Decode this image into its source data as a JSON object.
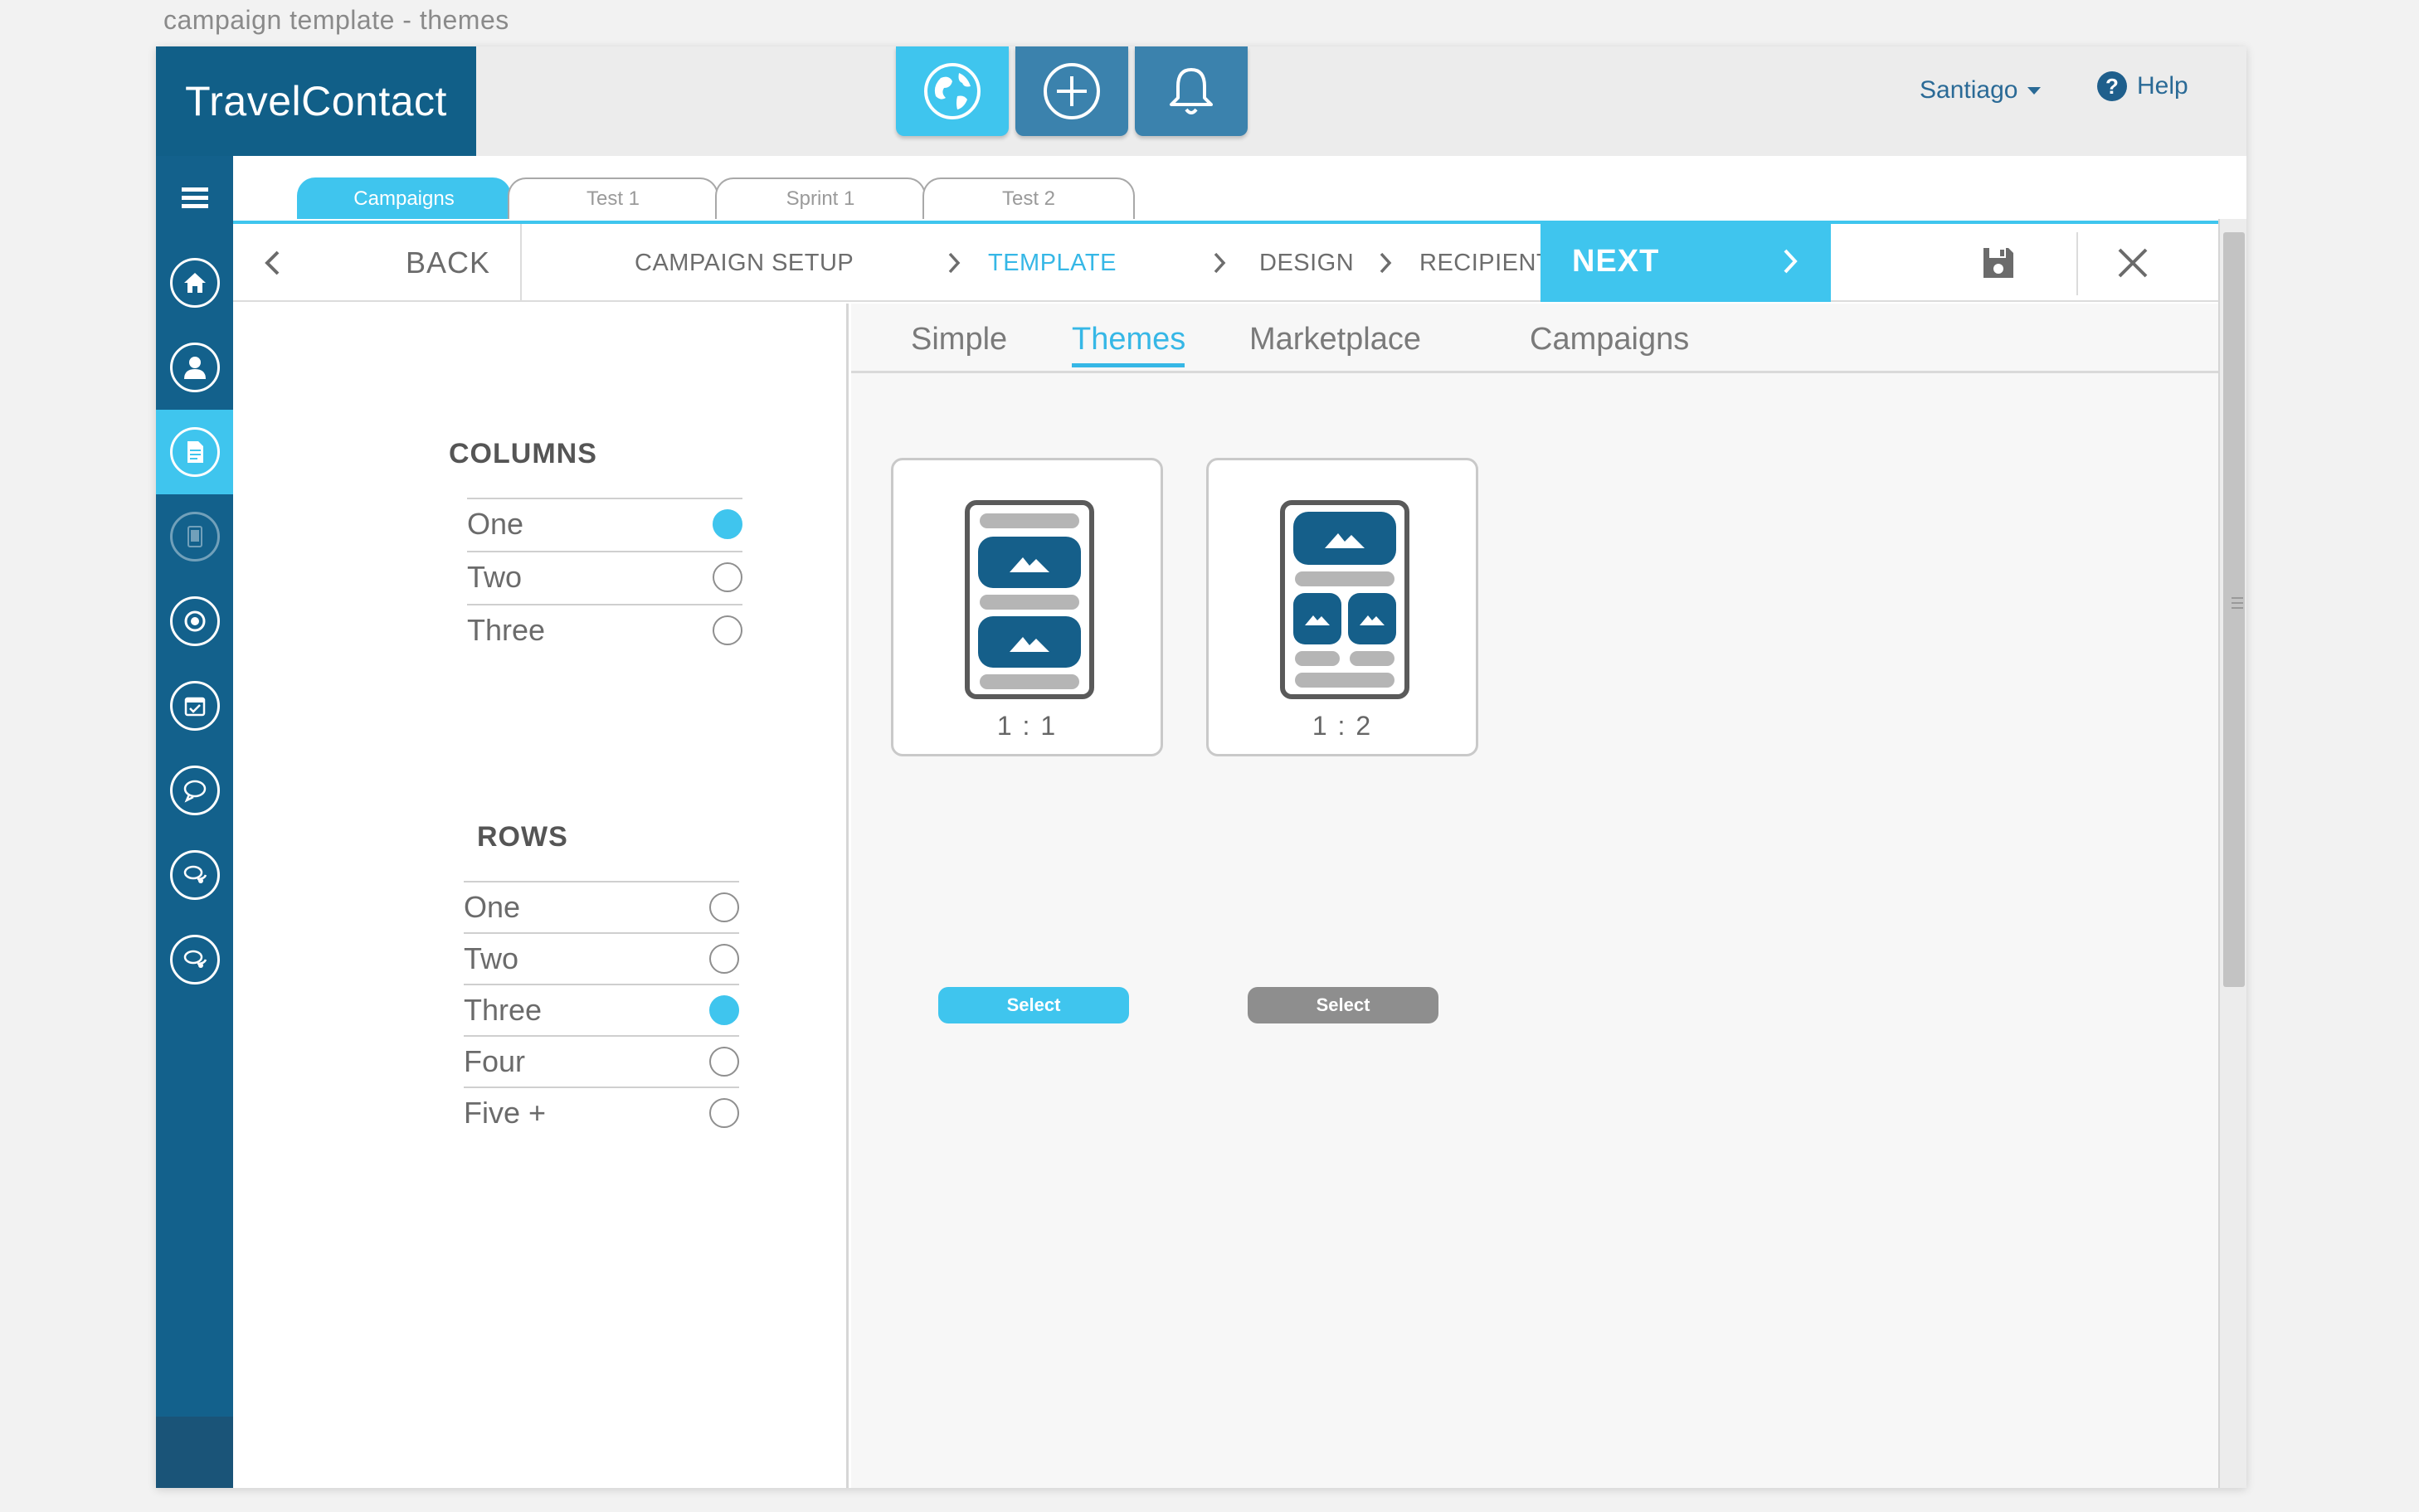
{
  "page_title": "campaign template - themes",
  "brand": {
    "logo_text": "TravelContact",
    "primary_color": "#115f88",
    "accent_color": "#3fc5ee"
  },
  "header": {
    "icons": [
      "globe-icon",
      "plus-circle-icon",
      "bell-icon"
    ],
    "user": "Santiago",
    "help": "Help"
  },
  "sidebar": {
    "icons": [
      "menu-icon",
      "home-icon",
      "user-icon",
      "document-icon",
      "tablet-icon",
      "target-icon",
      "calendar-icon",
      "chat-icon",
      "chat-group-icon",
      "chat-group-alt-icon"
    ],
    "active_index": 3
  },
  "file_tabs": [
    {
      "label": "Campaigns",
      "active": true
    },
    {
      "label": "Test 1",
      "active": false
    },
    {
      "label": "Sprint 1",
      "active": false
    },
    {
      "label": "Test 2",
      "active": false
    }
  ],
  "nav": {
    "back": "BACK",
    "steps": [
      "CAMPAIGN SETUP",
      "TEMPLATE",
      "DESIGN",
      "RECIPIENTS"
    ],
    "current_step": "TEMPLATE",
    "next": "NEXT"
  },
  "filters": {
    "columns": {
      "title": "COLUMNS",
      "options": [
        "One",
        "Two",
        "Three"
      ],
      "selected": "One"
    },
    "rows": {
      "title": "ROWS",
      "options": [
        "One",
        "Two",
        "Three",
        "Four",
        "Five +"
      ],
      "selected": "Three"
    }
  },
  "content_tabs": [
    {
      "label": "Simple",
      "active": false
    },
    {
      "label": "Themes",
      "active": true
    },
    {
      "label": "Marketplace",
      "active": false
    },
    {
      "label": "Campaigns",
      "active": false
    }
  ],
  "themes": [
    {
      "ratio": "1 : 1",
      "button": "Select",
      "button_color": "#3fc5ee"
    },
    {
      "ratio": "1 : 2",
      "button": "Select",
      "button_color": "#8e8e8e"
    }
  ]
}
